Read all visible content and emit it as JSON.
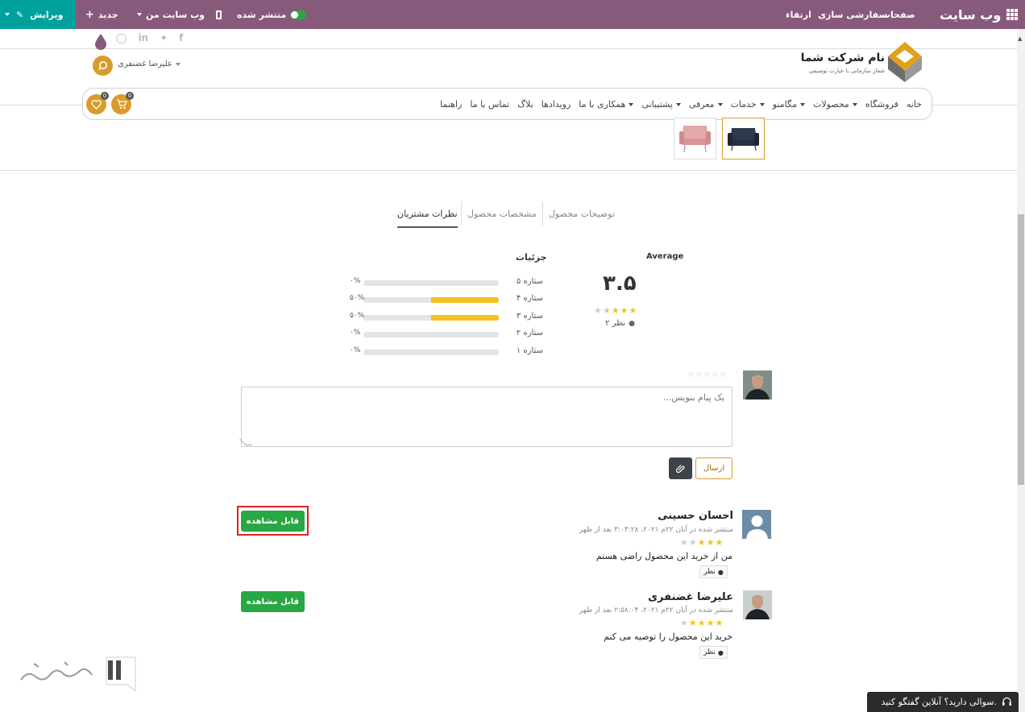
{
  "admin_bar": {
    "brand": "وب سایت",
    "menu": [
      "صفحات",
      "سفارشی سازی",
      "ارتقاء"
    ],
    "published": "منتشر شده",
    "my_website": "وب سایت من",
    "new": "جدید",
    "edit": "ویرایش"
  },
  "header": {
    "user_name": "علیرضا غضنفری",
    "logo_title": "نام شرکت شما",
    "logo_slogan": "شعار سازمانی یا عبارت توصیفی",
    "social": [
      "instagram-icon",
      "linkedin-icon",
      "twitter-icon",
      "facebook-icon"
    ],
    "nav": [
      "خانه",
      "فروشگاه",
      "محصولات",
      "مگامنو",
      "خدمات",
      "معرفی",
      "پشتیبانی",
      "همکاری با ما",
      "رویدادها",
      "بلاگ",
      "تماس با ما",
      "راهنما"
    ],
    "cart_count": "0",
    "wishlist_count": "0"
  },
  "tabs": [
    "توضیحات محصول",
    "مشخصات محصول",
    "نظرات مشتریان"
  ],
  "rating": {
    "average_label": "Average",
    "average_value": "۳.۵",
    "average_stars": 3.5,
    "review_count": "۲ نظر",
    "details_label": "جزئیات",
    "breakdown": [
      {
        "label": "۵ ستاره",
        "percent": 0,
        "percent_text": "۰%"
      },
      {
        "label": "۴ ستاره",
        "percent": 50,
        "percent_text": "۵۰%"
      },
      {
        "label": "۳ ستاره",
        "percent": 50,
        "percent_text": "۵۰%"
      },
      {
        "label": "۲ ستاره",
        "percent": 0,
        "percent_text": "۰%"
      },
      {
        "label": "۱ ستاره",
        "percent": 0,
        "percent_text": "۰%"
      }
    ]
  },
  "composer": {
    "placeholder": "یک پیام بنویس...",
    "send": "ارسال"
  },
  "reviews": [
    {
      "author": "احسان حسینی",
      "date": "منتشر شده در آبان ۲۲م ۲۰۲۱، ۳:۰۴:۲۸ بعد از ظهر",
      "stars": 3,
      "text": "من از خرید این محصول راضی هستم",
      "reply": "نظر",
      "visibility_button": "قابل مشاهده"
    },
    {
      "author": "علیرضا غضنفری",
      "date": "منتشر شده در آبان ۲۲م ۲۰۲۱، ۲:۵۸:۰۴ بعد از ظهر",
      "stars": 4,
      "text": "خرید این محصول را توصیه می کنم",
      "reply": "نظر",
      "visibility_button": "قابل مشاهده"
    }
  ],
  "chat": {
    "label": "سوالی دارید؟ آنلاین گفتگو کنید."
  },
  "colors": {
    "admin_bar": "#875a7b",
    "edit_button": "#00a09d",
    "accent": "#d99b2a",
    "star": "#f3c11e",
    "visible_button": "#28a745",
    "highlight": "#e02020"
  }
}
